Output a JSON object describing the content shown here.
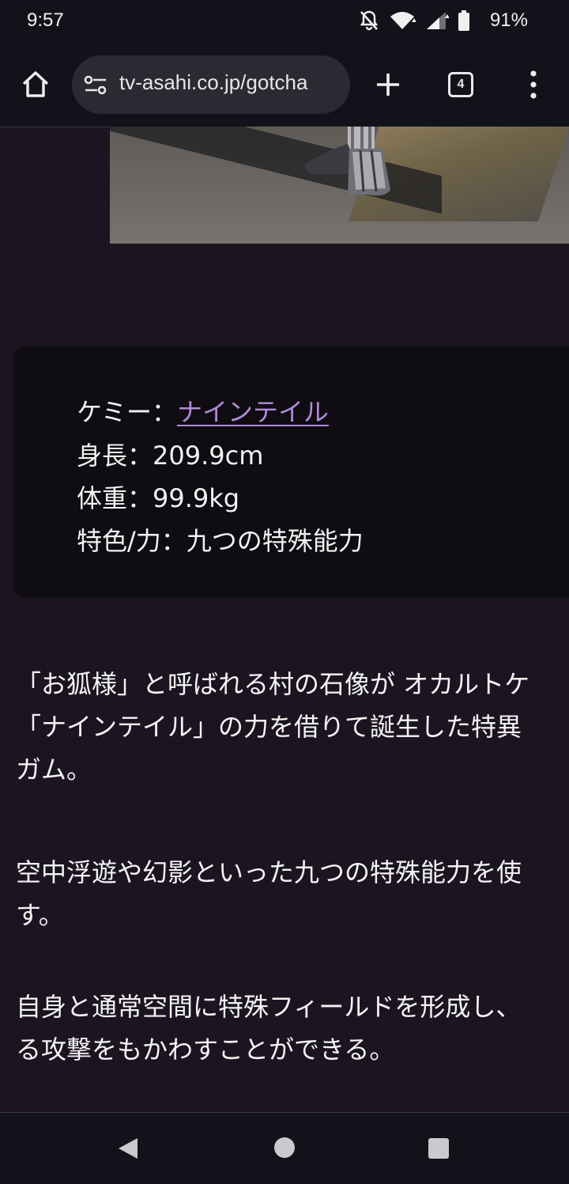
{
  "status_bar": {
    "time": "9:57",
    "battery_percent": "91%",
    "icons": [
      "notifications-off-icon",
      "wifi-icon",
      "cell-signal-icon",
      "battery-icon"
    ]
  },
  "browser": {
    "url": "tv-asahi.co.jp/gotcha",
    "tab_count": "4",
    "icons": [
      "home-icon",
      "site-settings-icon",
      "new-tab-icon",
      "tab-switcher-icon",
      "menu-icon"
    ]
  },
  "info": {
    "chemy_label": "ケミー：",
    "chemy_link": "ナインテイル",
    "height": "身長：209.9cm",
    "weight": "体重：99.9kg",
    "trait": "特色/力：九つの特殊能力"
  },
  "paragraphs": [
    [
      "「お狐様」と呼ばれる村の石像が オカルトケ",
      "「ナインテイル」の力を借りて誕生した特異",
      "ガム。"
    ],
    [
      "空中浮遊や幻影といった九つの特殊能力を使",
      "す。"
    ],
    [
      "自身と通常空間に特殊フィールドを形成し、",
      "る攻撃をもかわすことができる。"
    ]
  ],
  "nav": {
    "icons": [
      "back-icon",
      "home-circle-icon",
      "recents-icon"
    ]
  },
  "colors": {
    "page_bg": "#1b1521",
    "box_bg": "#0f0c12",
    "link": "#b18ad8",
    "chrome_bg": "#12121a"
  }
}
